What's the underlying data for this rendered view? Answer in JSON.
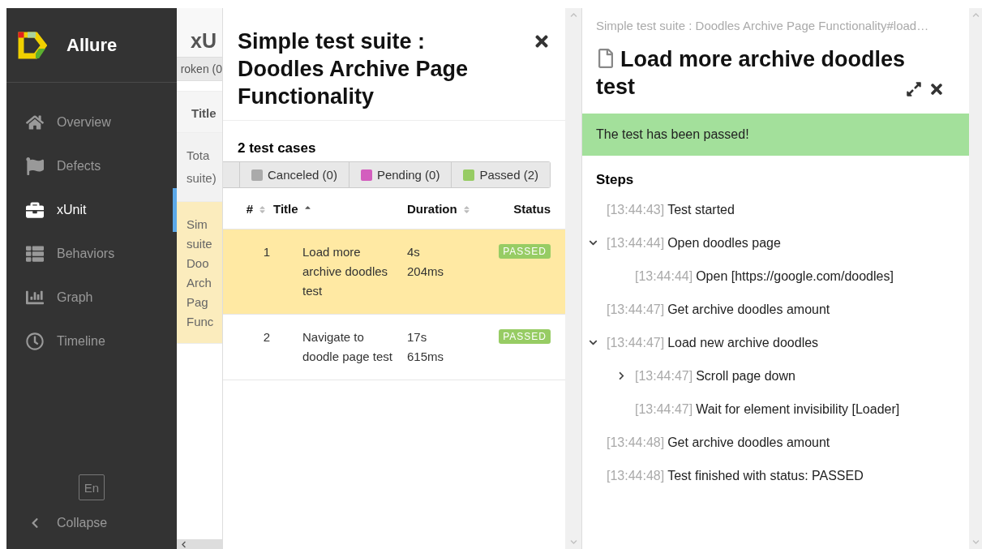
{
  "sidebar": {
    "brand": "Allure",
    "items": [
      {
        "label": "Overview",
        "selected": false
      },
      {
        "label": "Defects",
        "selected": false
      },
      {
        "label": "xUnit",
        "selected": true
      },
      {
        "label": "Behaviors",
        "selected": false
      },
      {
        "label": "Graph",
        "selected": false
      },
      {
        "label": "Timeline",
        "selected": false
      }
    ],
    "language": "En",
    "collapse": "Collapse"
  },
  "background_page": {
    "title": "xU",
    "tab": "roken (0",
    "column": "Title",
    "rows": [
      {
        "lines": [
          "Tota",
          "suite)"
        ],
        "selected": false
      },
      {
        "lines": [
          "Sim",
          "suite",
          "Doo",
          "Arch",
          "Pag",
          "Func"
        ],
        "selected": true
      }
    ]
  },
  "suite_panel": {
    "title": "Simple test suite : Doodles Archive Page Functionality",
    "count": "2 test cases",
    "filters": [
      {
        "label": "Canceled (0)",
        "color": "#aaaaaa"
      },
      {
        "label": "Pending (0)",
        "color": "#d35ebe"
      },
      {
        "label": "Passed (2)",
        "color": "#97cc64"
      }
    ],
    "columns": [
      {
        "label": "#"
      },
      {
        "label": "Title"
      },
      {
        "label": "Duration"
      },
      {
        "label": "Status"
      }
    ],
    "rows": [
      {
        "number": "1",
        "title": "Load more archive doodles test",
        "duration": "4s 204ms",
        "status": "PASSED",
        "selected": true
      },
      {
        "number": "2",
        "title": "Navigate to doodle page test",
        "duration": "17s 615ms",
        "status": "PASSED",
        "selected": false
      }
    ]
  },
  "test_panel": {
    "breadcrumb": "Simple test suite : Doodles Archive Page Functionality#load…",
    "title": "Load more archive doodles test",
    "banner": "The test has been passed!",
    "steps_title": "Steps",
    "steps": [
      {
        "time": "[13:44:43]",
        "name": "Test started",
        "kind": "leaf"
      },
      {
        "time": "[13:44:44]",
        "name": "Open doodles page",
        "kind": "group",
        "expanded": true,
        "children": [
          {
            "time": "[13:44:44]",
            "name": "Open [https://google.com/doodles]",
            "kind": "leaf"
          }
        ]
      },
      {
        "time": "[13:44:47]",
        "name": "Get archive doodles amount",
        "kind": "leaf"
      },
      {
        "time": "[13:44:47]",
        "name": "Load new archive doodles",
        "kind": "group",
        "expanded": true,
        "children": [
          {
            "time": "[13:44:47]",
            "name": "Scroll page down",
            "kind": "group",
            "expanded": false
          },
          {
            "time": "[13:44:47]",
            "name": "Wait for element invisibility [Loader]",
            "kind": "leaf"
          }
        ]
      },
      {
        "time": "[13:44:48]",
        "name": "Get archive doodles amount",
        "kind": "leaf"
      },
      {
        "time": "[13:44:48]",
        "name": "Test finished with status: PASSED",
        "kind": "leaf"
      }
    ]
  }
}
